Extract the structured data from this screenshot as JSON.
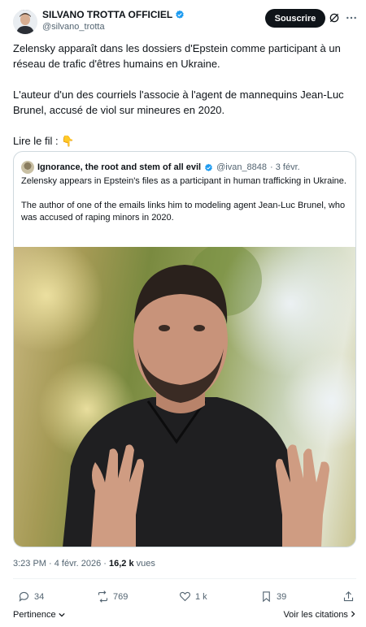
{
  "author": {
    "name": "SILVANO TROTTA OFFICIEL",
    "handle": "@silvano_trotta"
  },
  "follow_label": "Souscrire",
  "tweet": {
    "paragraph1": "Zelensky apparaît dans les dossiers d'Epstein comme participant à un réseau de trafic d'êtres humains en Ukraine.",
    "paragraph2": "L'auteur d'un des courriels l'associe à l'agent de mannequins Jean-Luc Brunel, accusé de viol sur mineures en 2020.",
    "paragraph3": "Lire le fil : 👇"
  },
  "quote": {
    "name": "Ignorance, the root and stem of all evil",
    "handle": "@ivan_8848",
    "date": "· 3 févr.",
    "paragraph1": "Zelensky appears in Epstein's files as a participant in human trafficking in Ukraine.",
    "paragraph2": "The author of one of the emails links him to modeling agent Jean-Luc Brunel, who was accused of raping minors in 2020."
  },
  "meta": {
    "time_date": "3:23 PM · 4 févr. 2026 · ",
    "views_count": "16,2 k",
    "views_label": " vues"
  },
  "actions": {
    "replies": "34",
    "reposts": "769",
    "likes": "1 k",
    "bookmarks": "39"
  },
  "footer": {
    "relevance": "Pertinence",
    "quotes": "Voir les citations"
  },
  "icons": [
    "verified-badge-icon",
    "grok-icon",
    "more-icon",
    "reply-icon",
    "repost-icon",
    "like-icon",
    "bookmark-icon",
    "share-icon",
    "chevron-down-icon",
    "chevron-right-icon"
  ],
  "colors": {
    "verified": "#1d9bf0",
    "text": "#0f1419",
    "secondary": "#536471",
    "border": "#cfd9de",
    "button": "#0f1419"
  }
}
